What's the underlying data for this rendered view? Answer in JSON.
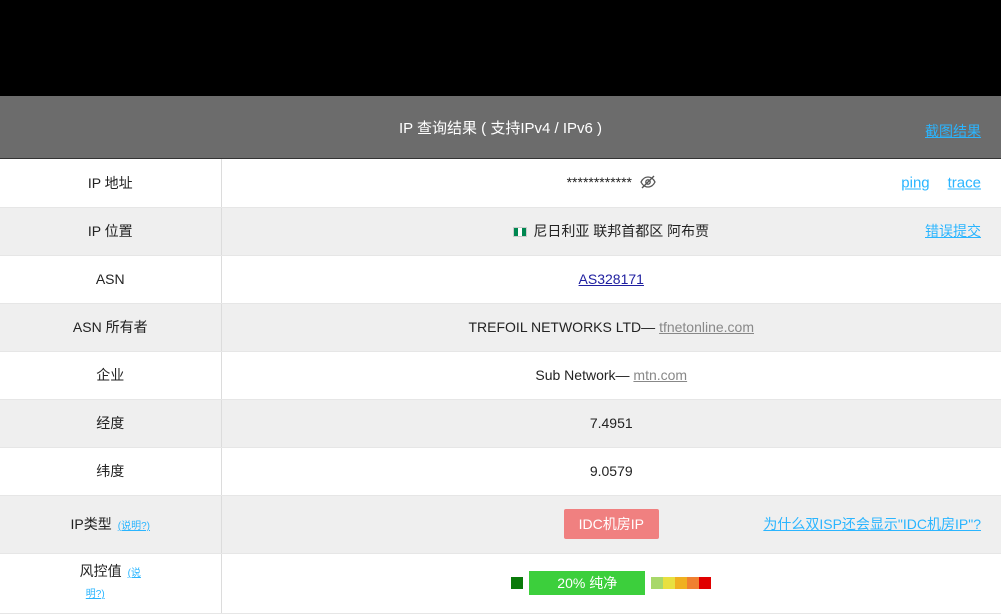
{
  "header": {
    "title": "IP 查询结果 ( 支持IPv4 / IPv6 )",
    "screenshot_link": "截图结果"
  },
  "rows": {
    "ip": {
      "label": "IP 地址",
      "value": "************",
      "links": [
        "ping",
        "trace"
      ]
    },
    "location": {
      "label": "IP 位置",
      "value": "尼日利亚 联邦首都区 阿布贾",
      "link": "错误提交"
    },
    "asn": {
      "label": "ASN",
      "value": "AS328171"
    },
    "asn_owner": {
      "label": "ASN 所有者",
      "value": "TREFOIL NETWORKS LTD— ",
      "domain": "tfnetonline.com"
    },
    "company": {
      "label": "企业",
      "value": "Sub Network— ",
      "domain": "mtn.com"
    },
    "longitude": {
      "label": "经度",
      "value": "7.4951"
    },
    "latitude": {
      "label": "纬度",
      "value": "9.0579"
    },
    "ip_type": {
      "label": "IP类型",
      "help": "(说明?)",
      "value": "IDC机房IP",
      "link": "为什么双ISP还会显示\"IDC机房IP\"?"
    },
    "risk": {
      "label": "风控值",
      "help_a": "(说",
      "help_b": "明?)",
      "value": "20%  纯净",
      "percent": 20
    }
  },
  "colors": {
    "link": "#2ab5ff",
    "idc_badge": "#f08080",
    "risk_bar": "#3ccf3c",
    "risk_scale": [
      "#a8d86a",
      "#e8e040",
      "#f0b020",
      "#f08030",
      "#e00000"
    ]
  }
}
